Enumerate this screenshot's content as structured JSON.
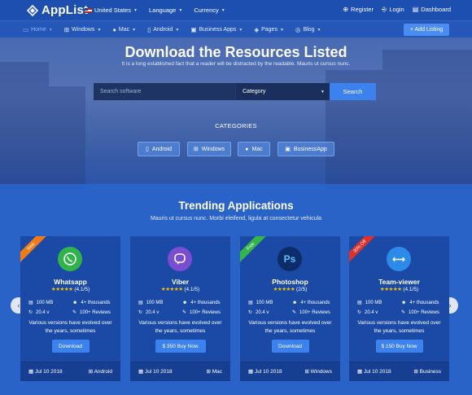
{
  "brand": {
    "name": "AppList"
  },
  "topbar": {
    "country": "United States",
    "language": "Language",
    "currency": "Currency",
    "register": "Register",
    "login": "Login",
    "dashboard": "Dashboard"
  },
  "nav": {
    "items": [
      {
        "label": "Home",
        "icon": "monitor-icon"
      },
      {
        "label": "Windows",
        "icon": "windows-icon"
      },
      {
        "label": "Mac",
        "icon": "apple-icon"
      },
      {
        "label": "Android",
        "icon": "android-icon"
      },
      {
        "label": "Business Apps",
        "icon": "briefcase-icon"
      },
      {
        "label": "Pages",
        "icon": "pages-icon"
      },
      {
        "label": "Blog",
        "icon": "blog-icon"
      }
    ],
    "add_listing": "+ Add Listing"
  },
  "hero": {
    "title": "Download the Resources Listed",
    "subtitle": "It is a long established fact that a reader will be distracted by the readable. Mauris ut cursus nunc.",
    "search_placeholder": "Search software",
    "category_value": "Category",
    "search_button": "Search",
    "categories_title": "CATEGORIES",
    "categories": [
      "Android",
      "Windows",
      "Mac",
      "BusinessApp"
    ]
  },
  "trending": {
    "title": "Trending Applications",
    "subtitle": "Mauris ut cursus nunc. Morbi eleifend, ligula at consectetur vehicula",
    "cards": [
      {
        "name": "Whatsapp",
        "rating": "(4.1/5)",
        "size": "100 MB",
        "users": "4+ thousands",
        "version": "20.4 v",
        "reviews": "100+ Reviews",
        "desc": "Various versions have evolved over the years, sometimes",
        "button": "Download",
        "date": "Jul 10 2018",
        "platform": "Android",
        "ribbon": "New",
        "ribbon_color": "#f07b17",
        "icon_color": "#2fb34a"
      },
      {
        "name": "Viber",
        "rating": "(4.1/5)",
        "size": "100 MB",
        "users": "4+ thousands",
        "version": "20.4 v",
        "reviews": "100+ Reviews",
        "desc": "Various versions have evolved over the years, sometimes",
        "button": "$ 350 Buy Now",
        "date": "Jul 10 2018",
        "platform": "Mac",
        "ribbon": "",
        "icon_color": "#7a4ed0"
      },
      {
        "name": "Photoshop",
        "rating": "(2/5)",
        "size": "100 MB",
        "users": "4+ thousands",
        "version": "20.4 v",
        "reviews": "100+ Reviews",
        "desc": "Various versions have evolved over the years, sometimes",
        "button": "Download",
        "date": "Jul 10 2018",
        "platform": "Windows",
        "ribbon": "Free",
        "ribbon_color": "#34b54a",
        "icon_color": "#1d5fb8"
      },
      {
        "name": "Team-viewer",
        "rating": "(4.1/5)",
        "size": "100 MB",
        "users": "4+ thousands",
        "version": "20.4 v",
        "reviews": "100+ Reviews",
        "desc": "Various versions have evolved over the years, sometimes",
        "button": "$ 150 Buy Now",
        "date": "Jul 10 2018",
        "platform": "Business",
        "ribbon": "30% Off",
        "ribbon_color": "#e0302a",
        "icon_color": "#2c8be8"
      }
    ]
  },
  "colors": {
    "primary": "#2a63c8",
    "topbar": "#1c4fb0",
    "accent": "#3b82ee",
    "star": "#f5c400"
  }
}
